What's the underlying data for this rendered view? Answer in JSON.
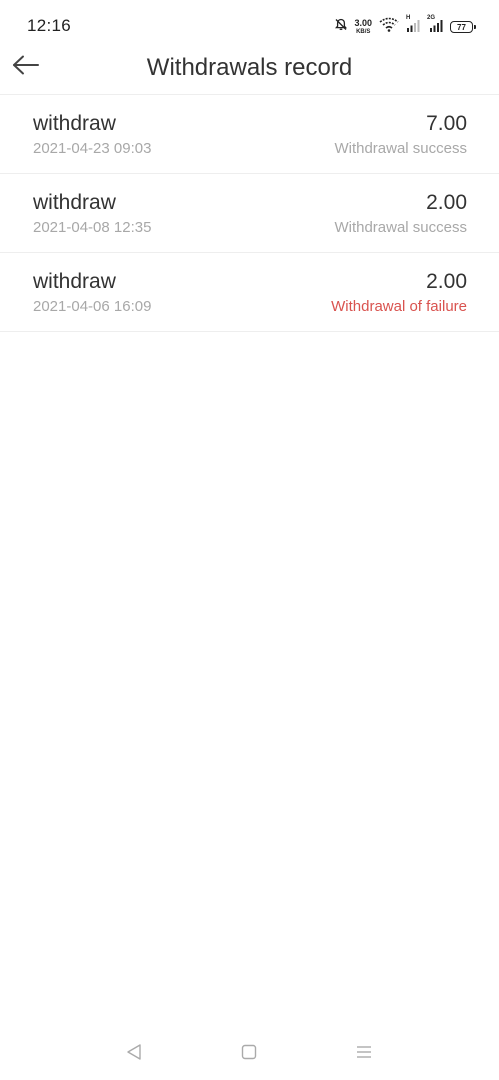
{
  "status_bar": {
    "time": "12:16",
    "net_speed_value": "3.00",
    "net_speed_unit": "KB/S",
    "signal1_label": "H",
    "signal2_label": "2G",
    "battery": "77",
    "icons": [
      "mute-bell-icon",
      "wifi-icon",
      "signal-icon",
      "signal-icon",
      "battery-icon"
    ]
  },
  "header": {
    "title": "Withdrawals record",
    "back_icon": "back-arrow-icon"
  },
  "records": [
    {
      "name": "withdraw",
      "date": "2021-04-23 09:03",
      "amount": "7.00",
      "status": "Withdrawal success",
      "status_type": "success"
    },
    {
      "name": "withdraw",
      "date": "2021-04-08 12:35",
      "amount": "2.00",
      "status": "Withdrawal success",
      "status_type": "success"
    },
    {
      "name": "withdraw",
      "date": "2021-04-06 16:09",
      "amount": "2.00",
      "status": "Withdrawal of failure",
      "status_type": "failure"
    }
  ],
  "colors": {
    "title_text": "#333333",
    "secondary_text": "#a8a8a8",
    "failure_text": "#d9534f",
    "divider": "#eeeeee"
  },
  "nav_bar": {
    "icons": [
      "nav-back-icon",
      "nav-home-icon",
      "nav-menu-icon"
    ]
  }
}
